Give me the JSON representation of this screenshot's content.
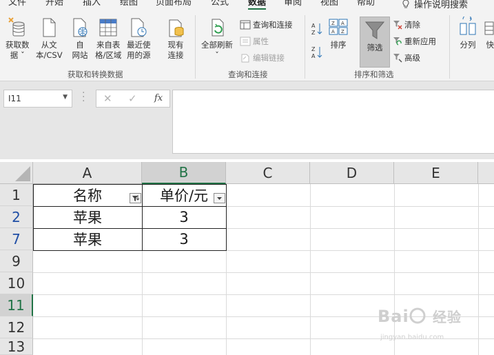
{
  "menu": {
    "tabs": [
      "文件",
      "开始",
      "插入",
      "绘图",
      "页面布局",
      "公式",
      "数据",
      "审阅",
      "视图",
      "帮助"
    ],
    "active_tab": "数据",
    "tell_me": "操作说明搜索"
  },
  "ribbon": {
    "get_data": {
      "group_label": "获取和转换数据",
      "get_data_btn": [
        "获取数",
        "据 ˇ"
      ],
      "from_text": [
        "从文",
        "本/CSV"
      ],
      "from_web": [
        "自",
        "网站"
      ],
      "from_table": [
        "来自表",
        "格/区域"
      ],
      "recent_sources": [
        "最近使",
        "用的源"
      ],
      "existing_conn": [
        "现有",
        "连接"
      ]
    },
    "queries": {
      "group_label": "查询和连接",
      "refresh_all": [
        "全部刷新",
        "ˇ"
      ],
      "queries_connections": "查询和连接",
      "properties": "属性",
      "edit_links": "编辑链接"
    },
    "sort_filter": {
      "group_label": "排序和筛选",
      "sort": "排序",
      "filter": "筛选",
      "clear": "清除",
      "reapply": "重新应用",
      "advanced": "高级"
    },
    "data_tools": {
      "split": "分列",
      "flash": "快速"
    }
  },
  "formula_bar": {
    "name_box": "I11",
    "fx": "fx",
    "content": ""
  },
  "sheet": {
    "columns": [
      "A",
      "B",
      "C",
      "D",
      "E"
    ],
    "selected_column": "B",
    "rows": [
      "1",
      "2",
      "7",
      "9",
      "10",
      "11",
      "12",
      "13"
    ],
    "filtered_rows": [
      "2",
      "7"
    ],
    "selected_row": "11",
    "cells": {
      "A1": "名称",
      "B1": "单价/元",
      "A2": "苹果",
      "B2": "3",
      "A7": "苹果",
      "B7": "3"
    }
  },
  "watermark": {
    "brand": "Bai 经验",
    "url": "jingyan.baidu.com"
  },
  "colors": {
    "excel_green": "#217346",
    "filtered_row_blue": "#1f4ea5"
  }
}
